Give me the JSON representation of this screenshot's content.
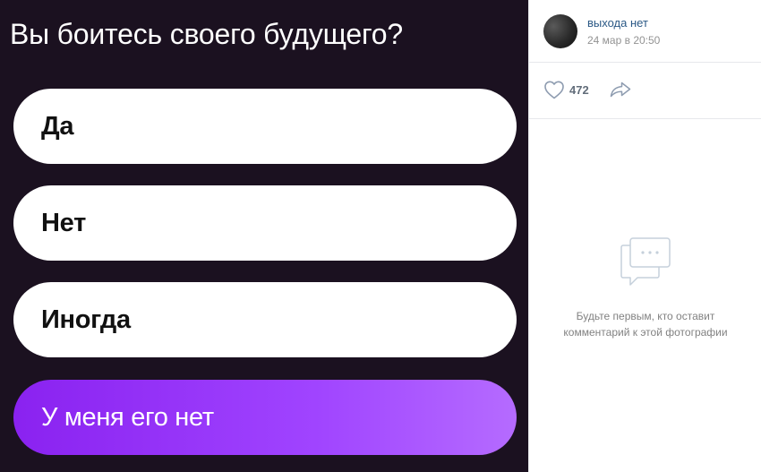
{
  "poll": {
    "question": "Вы боитесь своего будущего?",
    "options": [
      {
        "label": "Да"
      },
      {
        "label": "Нет"
      },
      {
        "label": "Иногда"
      },
      {
        "label": "У меня его нет"
      }
    ]
  },
  "post": {
    "author": "выхода нет",
    "date": "24 мар в 20:50",
    "likes": "472"
  },
  "comments": {
    "empty_line1": "Будьте первым, кто оставит",
    "empty_line2": "комментарий к этой фотографии"
  },
  "icons": {
    "like": "heart-icon",
    "share": "share-arrow-icon",
    "comments_empty": "comment-bubble-icon"
  },
  "colors": {
    "photo_bg": "#1b1120",
    "option_selected_start": "#8a22f0",
    "option_selected_end": "#b56bff",
    "link": "#2a5885"
  }
}
